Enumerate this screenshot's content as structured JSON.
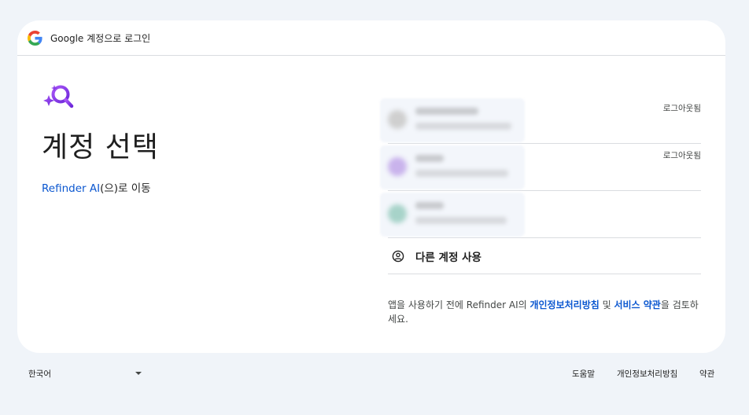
{
  "header": {
    "title": "Google 계정으로 로그인",
    "logo_icon": "google-g-icon"
  },
  "main": {
    "app_logo_icon": "sparkle-search-icon",
    "heading": "계정 선택",
    "continue": {
      "app_name": "Refinder AI",
      "suffix": "(으)로 이동"
    }
  },
  "accounts": [
    {
      "status": "로그아웃됨",
      "avatar_color": "#cfcfcf"
    },
    {
      "status": "로그아웃됨",
      "avatar_color": "#c9b3ec"
    },
    {
      "status": "",
      "avatar_color": "#a7d3c9"
    }
  ],
  "other_account": {
    "label": "다른 계정 사용",
    "icon": "account-circle-icon"
  },
  "notice": {
    "prefix": "앱을 사용하기 전에 Refinder AI의 ",
    "privacy": "개인정보처리방침",
    "middle": " 및 ",
    "terms": "서비스 약관",
    "suffix": "을 검토하세요."
  },
  "footer": {
    "language": "한국어",
    "help": "도움말",
    "privacy": "개인정보처리방침",
    "terms": "약관"
  },
  "colors": {
    "link": "#0b57d0",
    "background": "#f0f4f9",
    "accent": "#7c4dff"
  }
}
